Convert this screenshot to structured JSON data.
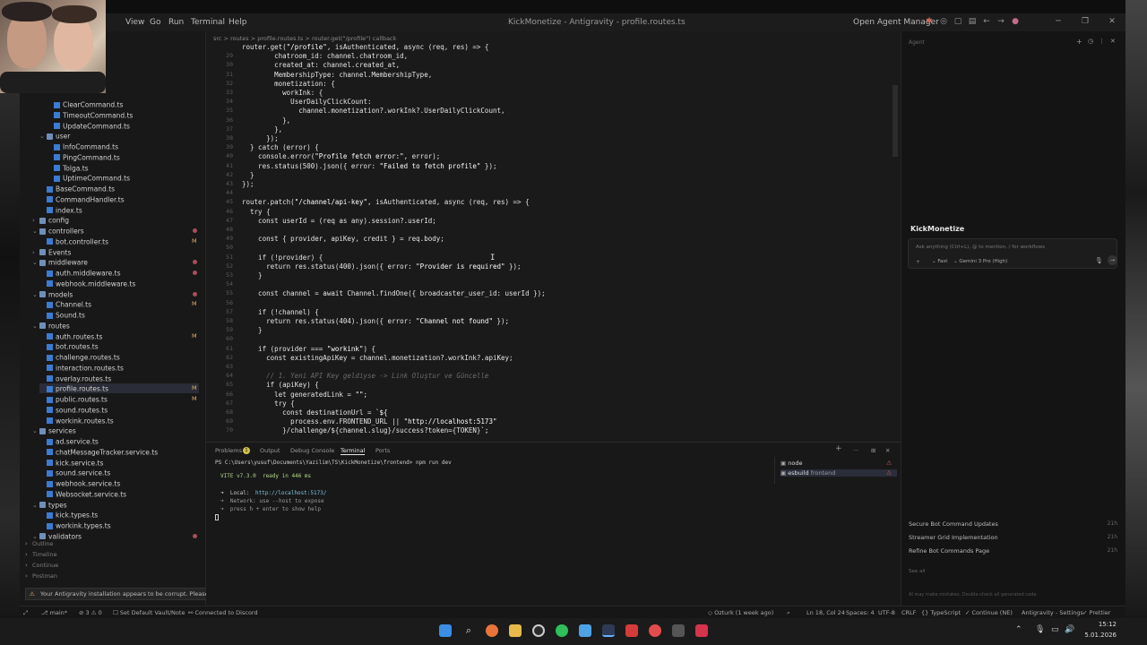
{
  "titlebar": {
    "menus": [
      "View",
      "Go",
      "Run",
      "Terminal",
      "Help"
    ],
    "title": "KickMonetize - Antigravity - profile.routes.ts",
    "open_agent_manager": "Open Agent Manager"
  },
  "breadcrumb": "src > routes > profile.routes.ts > router.get(\"/profile\") callback",
  "sidebar": {
    "tree": [
      {
        "label": "ClearCommand.ts",
        "type": "file",
        "depth": 3
      },
      {
        "label": "TimeoutCommand.ts",
        "type": "file",
        "depth": 3
      },
      {
        "label": "UpdateCommand.ts",
        "type": "file",
        "depth": 3
      },
      {
        "label": "user",
        "type": "folder",
        "depth": 2
      },
      {
        "label": "InfoCommand.ts",
        "type": "file",
        "depth": 3
      },
      {
        "label": "PingCommand.ts",
        "type": "file",
        "depth": 3
      },
      {
        "label": "Tolga.ts",
        "type": "file",
        "depth": 3
      },
      {
        "label": "UptimeCommand.ts",
        "type": "file",
        "depth": 3
      },
      {
        "label": "BaseCommand.ts",
        "type": "file",
        "depth": 2
      },
      {
        "label": "CommandHandler.ts",
        "type": "file",
        "depth": 2
      },
      {
        "label": "index.ts",
        "type": "file",
        "depth": 2
      },
      {
        "label": "config",
        "type": "folder",
        "depth": 1,
        "collapsed": true
      },
      {
        "label": "controllers",
        "type": "folder",
        "depth": 1,
        "dot": true
      },
      {
        "label": "bot.controller.ts",
        "type": "file",
        "depth": 2,
        "mark": "M"
      },
      {
        "label": "Events",
        "type": "folder",
        "depth": 1,
        "collapsed": true
      },
      {
        "label": "middleware",
        "type": "folder",
        "depth": 1,
        "dot": true
      },
      {
        "label": "auth.middleware.ts",
        "type": "file",
        "depth": 2,
        "dot": true
      },
      {
        "label": "webhook.middleware.ts",
        "type": "file",
        "depth": 2
      },
      {
        "label": "models",
        "type": "folder",
        "depth": 1,
        "dot": true
      },
      {
        "label": "Channel.ts",
        "type": "file",
        "depth": 2,
        "mark": "M"
      },
      {
        "label": "Sound.ts",
        "type": "file",
        "depth": 2
      },
      {
        "label": "routes",
        "type": "folder",
        "depth": 1
      },
      {
        "label": "auth.routes.ts",
        "type": "file",
        "depth": 2,
        "mark": "M"
      },
      {
        "label": "bot.routes.ts",
        "type": "file",
        "depth": 2
      },
      {
        "label": "challenge.routes.ts",
        "type": "file",
        "depth": 2
      },
      {
        "label": "interaction.routes.ts",
        "type": "file",
        "depth": 2
      },
      {
        "label": "overlay.routes.ts",
        "type": "file",
        "depth": 2
      },
      {
        "label": "profile.routes.ts",
        "type": "file",
        "depth": 2,
        "mark": "M",
        "selected": true
      },
      {
        "label": "public.routes.ts",
        "type": "file",
        "depth": 2,
        "mark": "M"
      },
      {
        "label": "sound.routes.ts",
        "type": "file",
        "depth": 2
      },
      {
        "label": "workink.routes.ts",
        "type": "file",
        "depth": 2
      },
      {
        "label": "services",
        "type": "folder",
        "depth": 1
      },
      {
        "label": "ad.service.ts",
        "type": "file",
        "depth": 2
      },
      {
        "label": "chatMessageTracker.service.ts",
        "type": "file",
        "depth": 2
      },
      {
        "label": "kick.service.ts",
        "type": "file",
        "depth": 2
      },
      {
        "label": "sound.service.ts",
        "type": "file",
        "depth": 2
      },
      {
        "label": "webhook.service.ts",
        "type": "file",
        "depth": 2
      },
      {
        "label": "Websocket.service.ts",
        "type": "file",
        "depth": 2
      },
      {
        "label": "types",
        "type": "folder",
        "depth": 1
      },
      {
        "label": "kick.types.ts",
        "type": "file",
        "depth": 2
      },
      {
        "label": "workink.types.ts",
        "type": "file",
        "depth": 2
      },
      {
        "label": "validators",
        "type": "folder",
        "depth": 1,
        "dot": true
      }
    ],
    "sections": [
      "Outline",
      "Timeline",
      "Continue",
      "Postman"
    ]
  },
  "editor": {
    "lines": [
      {
        "n": "",
        "code": "router.get(\"/profile\", isAuthenticated, async (req, res) => {"
      },
      {
        "n": "29",
        "code": "        chatroom_id: channel.chatroom_id,"
      },
      {
        "n": "30",
        "code": "        created_at: channel.created_at,"
      },
      {
        "n": "31",
        "code": "        MembershipType: channel.MembershipType,"
      },
      {
        "n": "32",
        "code": "        monetization: {"
      },
      {
        "n": "33",
        "code": "          workInk: {"
      },
      {
        "n": "34",
        "code": "            UserDailyClickCount:"
      },
      {
        "n": "35",
        "code": "              channel.monetization?.workInk?.UserDailyClickCount,"
      },
      {
        "n": "36",
        "code": "          },"
      },
      {
        "n": "37",
        "code": "        },"
      },
      {
        "n": "38",
        "code": "      });"
      },
      {
        "n": "39",
        "code": "  } catch (error) {"
      },
      {
        "n": "40",
        "code": "    console.error(\"Profile fetch error:\", error);"
      },
      {
        "n": "41",
        "code": "    res.status(500).json({ error: \"Failed to fetch profile\" });"
      },
      {
        "n": "42",
        "code": "  }"
      },
      {
        "n": "43",
        "code": "});"
      },
      {
        "n": "44",
        "code": ""
      },
      {
        "n": "45",
        "code": "router.patch(\"/channel/api-key\", isAuthenticated, async (req, res) => {"
      },
      {
        "n": "46",
        "code": "  try {"
      },
      {
        "n": "47",
        "code": "    const userId = (req as any).session?.userId;"
      },
      {
        "n": "48",
        "code": ""
      },
      {
        "n": "49",
        "code": "    const { provider, apiKey, credit } = req.body;"
      },
      {
        "n": "50",
        "code": ""
      },
      {
        "n": "51",
        "code": "    if (!provider) {"
      },
      {
        "n": "52",
        "code": "      return res.status(400).json({ error: \"Provider is required\" });"
      },
      {
        "n": "53",
        "code": "    }"
      },
      {
        "n": "54",
        "code": ""
      },
      {
        "n": "55",
        "code": "    const channel = await Channel.findOne({ broadcaster_user_id: userId });"
      },
      {
        "n": "56",
        "code": ""
      },
      {
        "n": "57",
        "code": "    if (!channel) {"
      },
      {
        "n": "58",
        "code": "      return res.status(404).json({ error: \"Channel not found\" });"
      },
      {
        "n": "59",
        "code": "    }"
      },
      {
        "n": "60",
        "code": ""
      },
      {
        "n": "61",
        "code": "    if (provider === \"workink\") {"
      },
      {
        "n": "62",
        "code": "      const existingApiKey = channel.monetization?.workInk?.apiKey;"
      },
      {
        "n": "63",
        "code": ""
      },
      {
        "n": "64",
        "code": "      // 1. Yeni API Key geldiyse -> Link Oluştur ve Güncelle"
      },
      {
        "n": "65",
        "code": "      if (apiKey) {"
      },
      {
        "n": "66",
        "code": "        let generatedLink = \"\";"
      },
      {
        "n": "67",
        "code": "        try {"
      },
      {
        "n": "68",
        "code": "          const destinationUrl = `${"
      },
      {
        "n": "69",
        "code": "            process.env.FRONTEND_URL || \"http://localhost:5173\""
      },
      {
        "n": "70",
        "code": "          }/challenge/${channel.slug}/success?token={TOKEN}`;"
      }
    ]
  },
  "terminal": {
    "tabs": [
      "Problems",
      "Output",
      "Debug Console",
      "Terminal",
      "Ports"
    ],
    "active_tab": "Terminal",
    "problems_count": "1",
    "prompt": "PS C:\\Users\\yusuf\\Documents\\Yazilim\\TS\\KickMonetize\\frontend> npm run dev",
    "vite_line": "VITE v7.3.0  ready in 446 ms",
    "local_label": "➜  Local:",
    "local_url": "http://localhost:5173/",
    "network_line": "➜  Network: use --host to expose",
    "help_line": "➜  press h + enter to show help",
    "sessions": [
      {
        "name": "node",
        "warn": true
      },
      {
        "name": "esbuild",
        "sub": "frontend",
        "warn": true
      }
    ]
  },
  "agent": {
    "header": "Agent",
    "title": "KickMonetize",
    "input_placeholder": "Ask anything (Ctrl+L), @ to mention, / for workflows",
    "mode": "Fast",
    "model": "Gemini 3 Pro (High)",
    "history": [
      {
        "title": "Secure Bot Command Updates",
        "age": "21h"
      },
      {
        "title": "Streamer Grid Implementation",
        "age": "21h"
      },
      {
        "title": "Refine Bot Commands Page",
        "age": "21h"
      }
    ],
    "see_all": "See all",
    "disclaimer": "AI may make mistakes. Double-check all generated code."
  },
  "toast": "Your Antigravity installation appears to be corrupt. Please reinstall.",
  "statusbar": {
    "branch": "main*",
    "sync": "⊘ 3  ⚠ 0",
    "vault": "Set Default Vault/Note",
    "discord": "Connected to Discord",
    "author": "Ozturk (1 week ago)",
    "position": "Ln 18, Col 24",
    "spaces": "Spaces: 4",
    "encoding": "UTF-8",
    "eol": "CRLF",
    "language": "TypeScript",
    "continue": "Continue (NE)",
    "settings": "Antigravity - Settings",
    "prettier": "Prettier"
  },
  "taskbar": {
    "time": "15:12",
    "date": "5.01.2026"
  }
}
